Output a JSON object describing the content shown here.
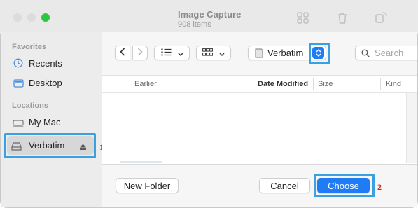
{
  "background_window": {
    "title": "Image Capture",
    "subtitle": "908 items"
  },
  "sidebar": {
    "favorites_heading": "Favorites",
    "favorites": [
      {
        "label": "Recents",
        "icon": "clock-icon"
      },
      {
        "label": "Desktop",
        "icon": "desktop-icon"
      }
    ],
    "locations_heading": "Locations",
    "locations": [
      {
        "label": "My Mac",
        "icon": "computer-icon"
      },
      {
        "label": "Verbatim",
        "icon": "external-drive-icon",
        "selected": true
      }
    ]
  },
  "toolbar": {
    "location": "Verbatim",
    "search_placeholder": "Search"
  },
  "columns": {
    "name_group": "Earlier",
    "date_modified": "Date Modified",
    "size": "Size",
    "kind": "Kind"
  },
  "footer": {
    "new_folder": "New Folder",
    "cancel": "Cancel",
    "choose": "Choose"
  },
  "annotations": [
    "1",
    "2"
  ],
  "colors": {
    "accent": "#1e7cf5",
    "annotation_box": "#3aa0e0",
    "annotation_text": "#d0211c"
  }
}
